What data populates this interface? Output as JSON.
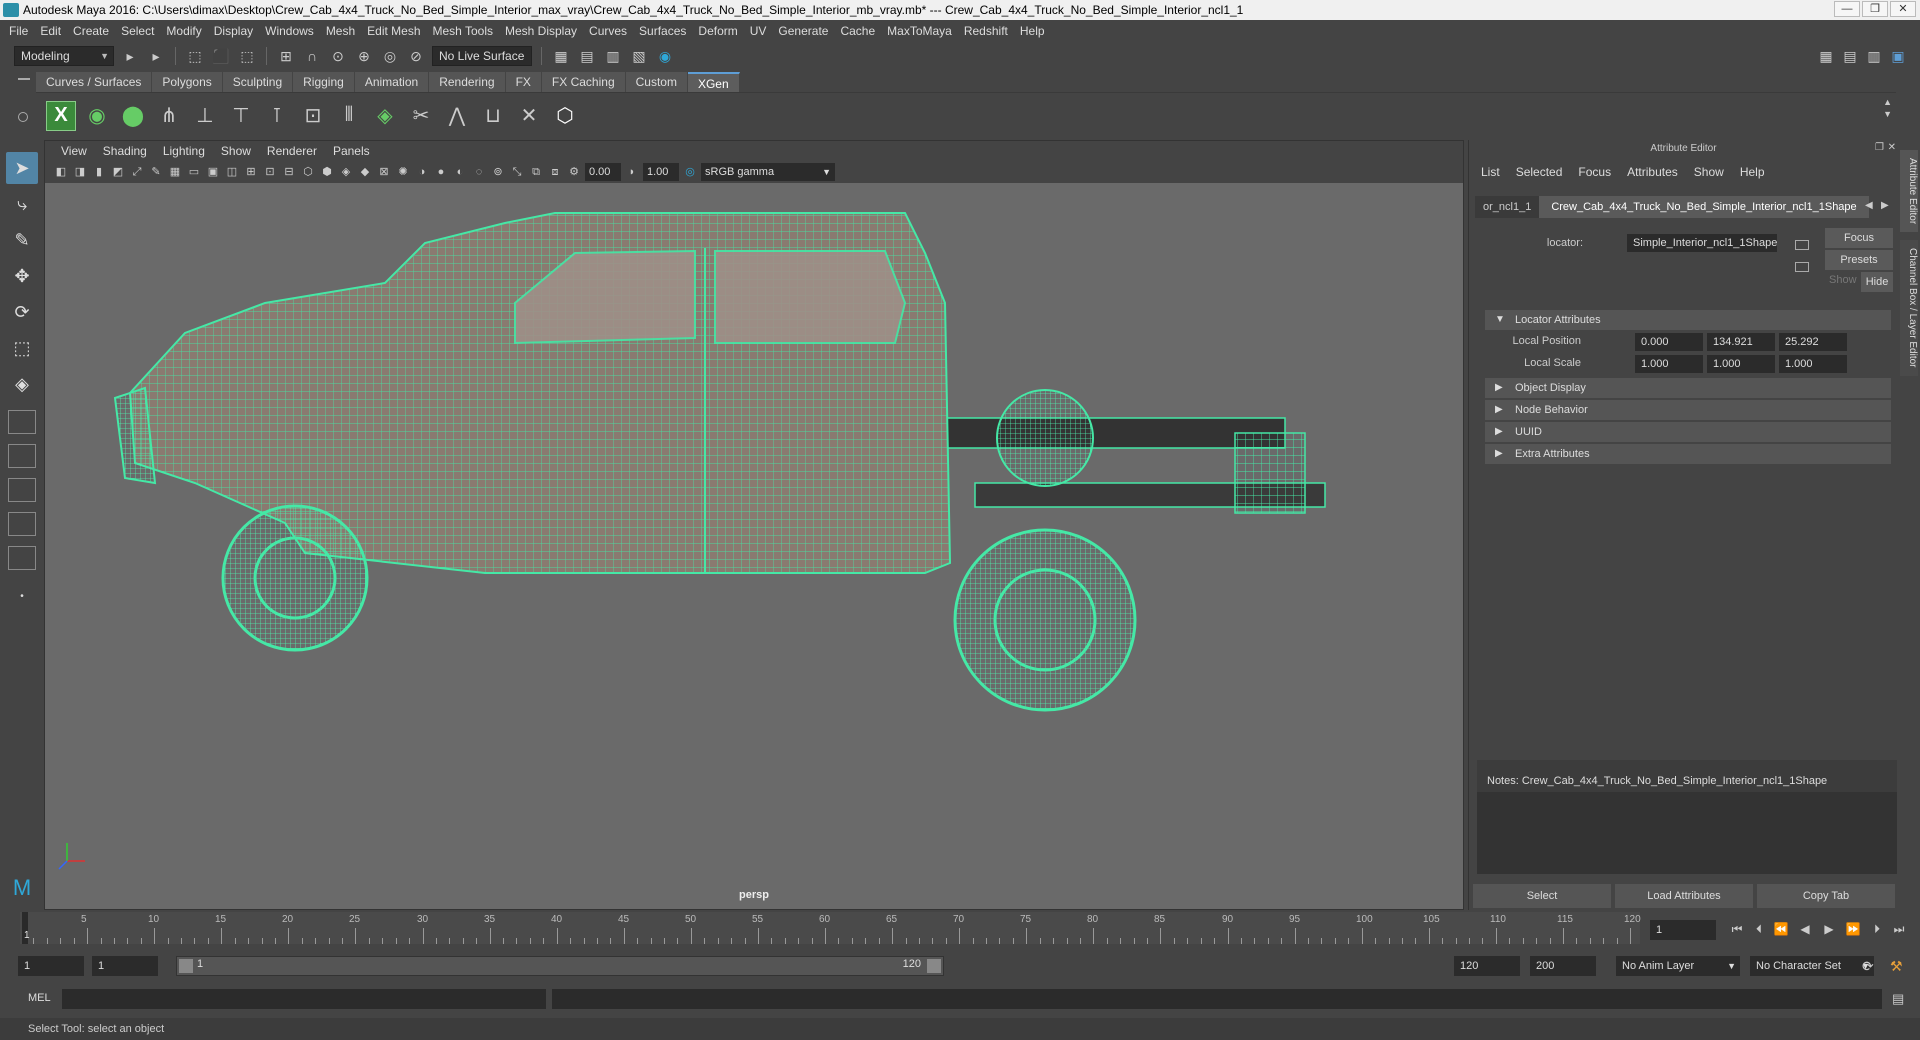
{
  "window": {
    "title": "Autodesk Maya 2016: C:\\Users\\dimax\\Desktop\\Crew_Cab_4x4_Truck_No_Bed_Simple_Interior_max_vray\\Crew_Cab_4x4_Truck_No_Bed_Simple_Interior_mb_vray.mb*   ---   Crew_Cab_4x4_Truck_No_Bed_Simple_Interior_ncl1_1",
    "minimize": "—",
    "maximize": "❐",
    "close": "✕"
  },
  "menubar": [
    "File",
    "Edit",
    "Create",
    "Select",
    "Modify",
    "Display",
    "Windows",
    "Mesh",
    "Edit Mesh",
    "Mesh Tools",
    "Mesh Display",
    "Curves",
    "Surfaces",
    "Deform",
    "UV",
    "Generate",
    "Cache",
    "MaxToMaya",
    "Redshift",
    "Help"
  ],
  "statusline": {
    "mode": "Modeling",
    "live_surface": "No Live Surface"
  },
  "shelf_tabs": [
    "Curves / Surfaces",
    "Polygons",
    "Sculpting",
    "Rigging",
    "Animation",
    "Rendering",
    "FX",
    "FX Caching",
    "Custom",
    "XGen"
  ],
  "shelf_active": "XGen",
  "viewport": {
    "menu": [
      "View",
      "Shading",
      "Lighting",
      "Show",
      "Renderer",
      "Panels"
    ],
    "exposure": "0.00",
    "gamma": "1.00",
    "color_space": "sRGB gamma",
    "camera": "persp"
  },
  "attribute_editor": {
    "title": "Attribute Editor",
    "menu": [
      "List",
      "Selected",
      "Focus",
      "Attributes",
      "Show",
      "Help"
    ],
    "tab_prev": "or_ncl1_1",
    "tab_active": "Crew_Cab_4x4_Truck_No_Bed_Simple_Interior_ncl1_1Shape",
    "focus_btn": "Focus",
    "presets_btn": "Presets",
    "show_btn": "Show",
    "hide_btn": "Hide",
    "node_label": "locator:",
    "node_value": "Simple_Interior_ncl1_1Shape",
    "sections": [
      "Locator Attributes",
      "Object Display",
      "Node Behavior",
      "UUID",
      "Extra Attributes"
    ],
    "local_position_label": "Local Position",
    "local_position": [
      "0.000",
      "134.921",
      "25.292"
    ],
    "local_scale_label": "Local Scale",
    "local_scale": [
      "1.000",
      "1.000",
      "1.000"
    ],
    "notes_label": "Notes:  Crew_Cab_4x4_Truck_No_Bed_Simple_Interior_ncl1_1Shape",
    "buttons": [
      "Select",
      "Load Attributes",
      "Copy Tab"
    ]
  },
  "side_tabs": [
    "Attribute Editor",
    "Channel Box / Layer Editor"
  ],
  "timeline": {
    "ticks": [
      "5",
      "10",
      "15",
      "20",
      "25",
      "30",
      "35",
      "40",
      "45",
      "50",
      "55",
      "60",
      "65",
      "70",
      "75",
      "80",
      "85",
      "90",
      "95",
      "100",
      "105",
      "110",
      "115",
      "120"
    ],
    "start_marker": "1",
    "current_frame": "1"
  },
  "range": {
    "start": "1",
    "playback_start": "1",
    "slider_start": "1",
    "slider_end": "120",
    "playback_end": "120",
    "end": "200",
    "anim_layer": "No Anim Layer",
    "character_set": "No Character Set"
  },
  "command": {
    "label": "MEL"
  },
  "help_line": "Select Tool: select an object"
}
